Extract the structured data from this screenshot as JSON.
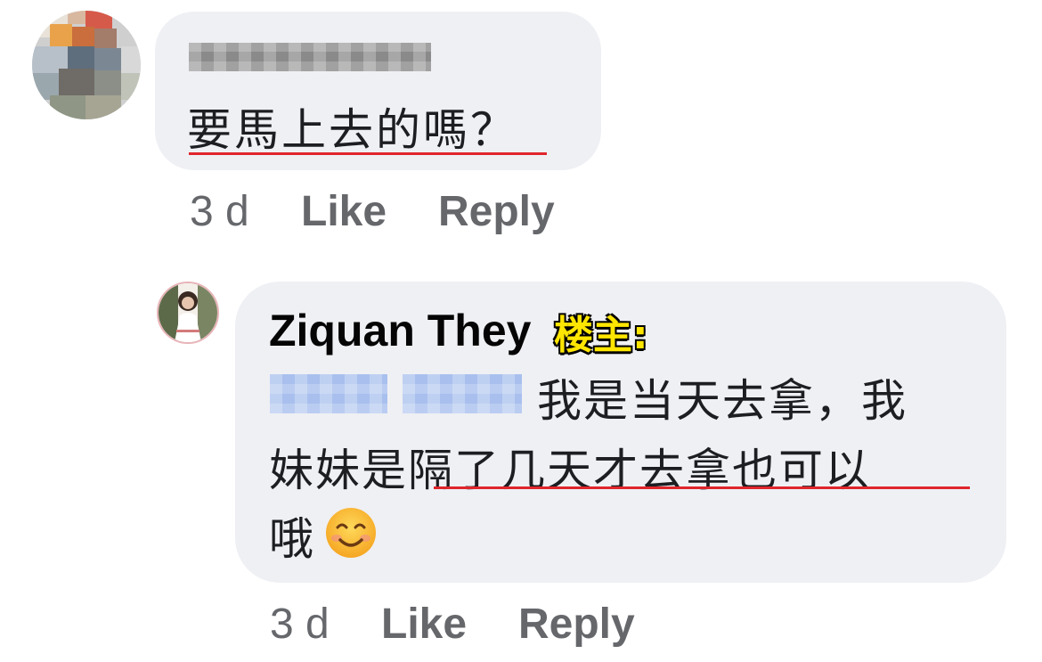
{
  "comments": [
    {
      "author": "",
      "text": "要馬上去的嗎？",
      "time": "3 d",
      "like_label": "Like",
      "reply_label": "Reply"
    },
    {
      "author": "Ziquan They",
      "author_badge": "楼主:",
      "text_line_1": "我是当天去拿，我",
      "text_line_2": "妹妹是隔了几天才去拿也可以",
      "text_line_3": "哦",
      "emoji": "smiling-face-icon",
      "time": "3 d",
      "like_label": "Like",
      "reply_label": "Reply"
    }
  ],
  "colors": {
    "bubble": "#eff0f4",
    "meta_text": "#65676b",
    "underline": "#e0262b",
    "badge": "#ffe600"
  }
}
